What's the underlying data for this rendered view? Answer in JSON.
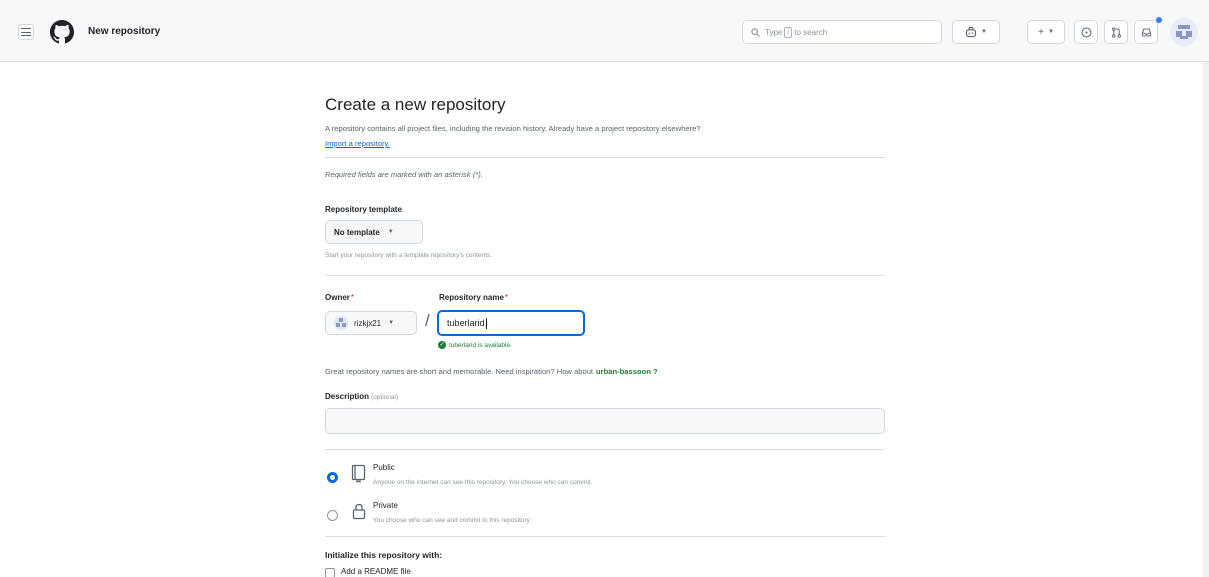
{
  "header": {
    "page_name": "New repository",
    "search_placeholder_pre": "Type",
    "search_key": "/",
    "search_placeholder_post": "to search",
    "plus_label": "+"
  },
  "main": {
    "title": "Create a new repository",
    "subtitle": "A repository contains all project files, including the revision history. Already have a project repository elsewhere?",
    "import_link": "Import a repository.",
    "required_note": "Required fields are marked with an asterisk (*).",
    "template": {
      "label": "Repository template",
      "value": "No template",
      "hint": "Start your repository with a template repository's contents."
    },
    "owner": {
      "label": "Owner",
      "asterisk": "*",
      "value": "rizkjx21"
    },
    "repo_name": {
      "label": "Repository name",
      "asterisk": "*",
      "value": "tuberlarid",
      "available": "tuberlarid is available."
    },
    "slash": "/",
    "suggestion_text": "Great repository names are short and memorable. Need inspiration? How about",
    "suggestion_name": "urban-bassoon ?",
    "description": {
      "label": "Description",
      "optional": "(optional)",
      "value": ""
    },
    "visibility": {
      "public_title": "Public",
      "public_desc": "Anyone on the internet can see this repository. You choose who can commit.",
      "private_title": "Private",
      "private_desc": "You choose who can see and commit to this repository.",
      "selected": "public"
    },
    "init_title": "Initialize this repository with:",
    "readme_label": "Add a README file"
  },
  "colors": {
    "accent": "#0969da",
    "success": "#1a7f37",
    "header_bg": "#f6f8fa"
  }
}
